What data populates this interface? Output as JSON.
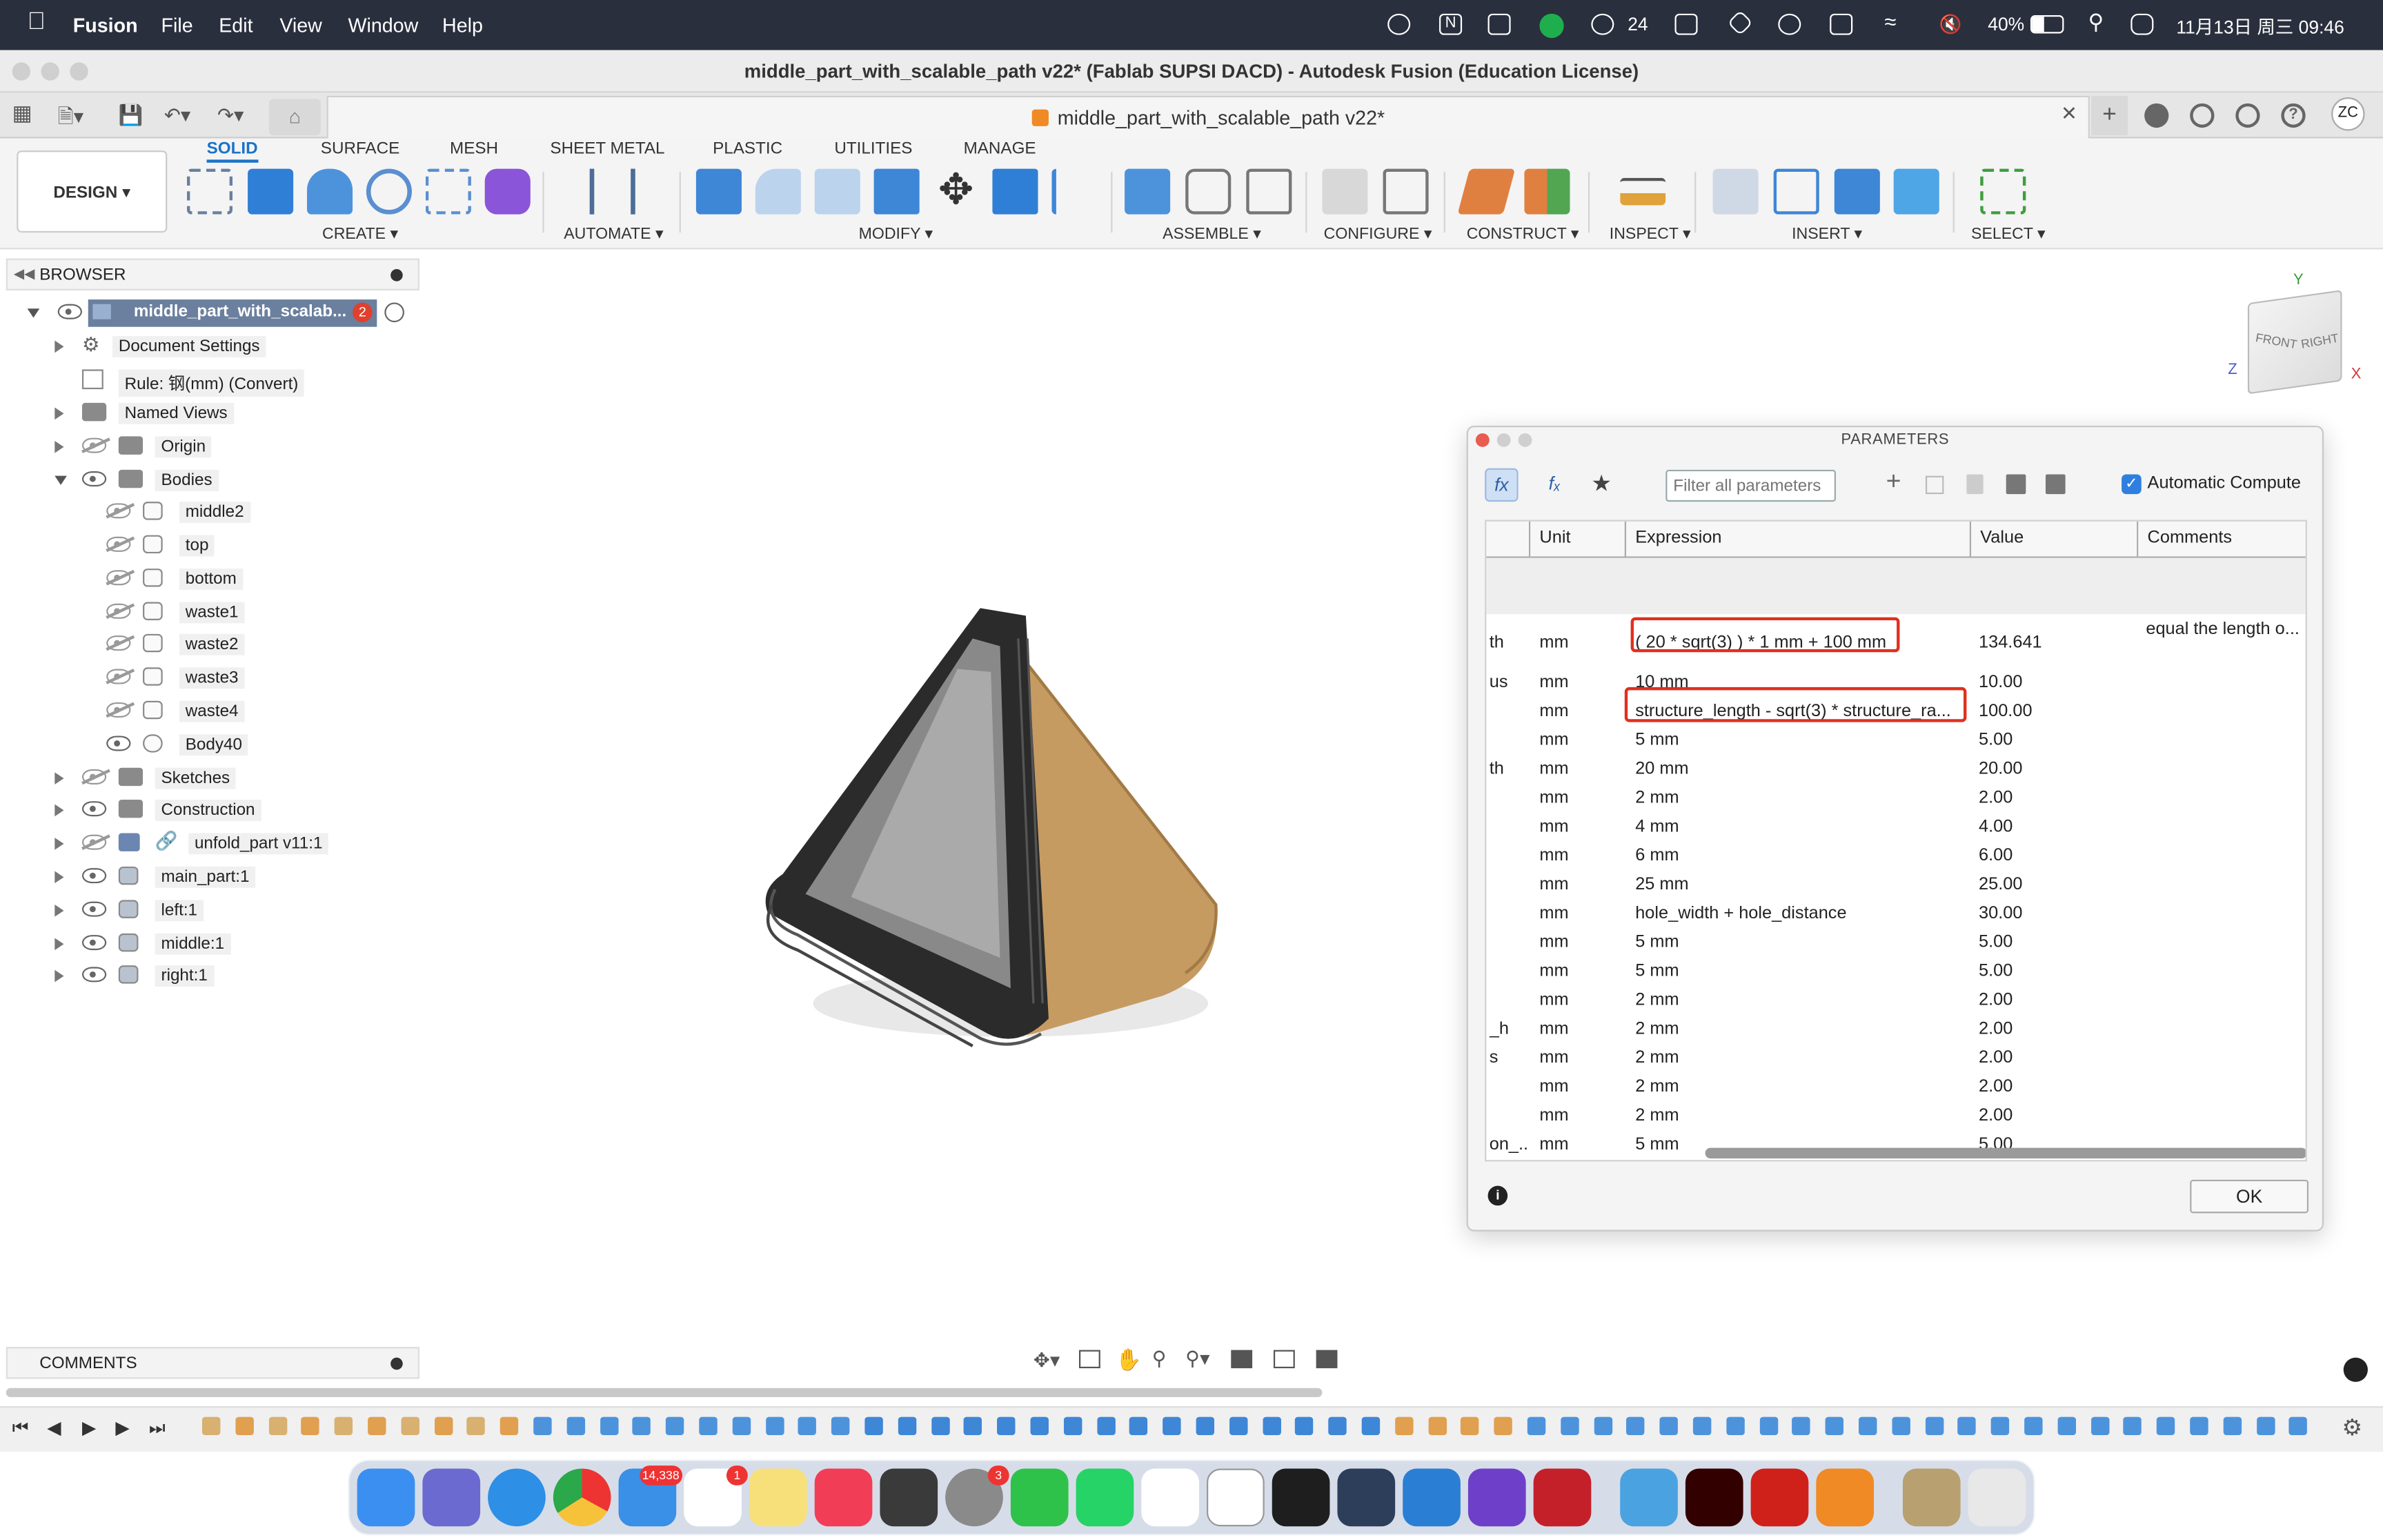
{
  "menubar": {
    "app": "Fusion",
    "items": [
      "File",
      "Edit",
      "View",
      "Window",
      "Help"
    ],
    "wechat_count": "24",
    "battery": "40%",
    "clock": "11月13日 周三 09:46"
  },
  "window": {
    "title": "middle_part_with_scalable_path v22* (Fablab SUPSI DACD) - Autodesk Fusion (Education License)",
    "doc_tab": "middle_part_with_scalable_path v22*",
    "user_initials": "ZC"
  },
  "toolbar": {
    "workspace": "DESIGN ▾",
    "tabs": [
      "SOLID",
      "SURFACE",
      "MESH",
      "SHEET METAL",
      "PLASTIC",
      "UTILITIES",
      "MANAGE"
    ],
    "groups": [
      "CREATE ▾",
      "AUTOMATE ▾",
      "MODIFY ▾",
      "ASSEMBLE ▾",
      "CONFIGURE ▾",
      "CONSTRUCT ▾",
      "INSPECT ▾",
      "INSERT ▾",
      "SELECT ▾"
    ]
  },
  "browser": {
    "title": "BROWSER",
    "root": "middle_part_with_scalab...",
    "root_badge": "2",
    "document_settings": "Document Settings",
    "rule": "Rule: 钢(mm) (Convert)",
    "named_views": "Named Views",
    "origin": "Origin",
    "bodies": "Bodies",
    "body_items": [
      "middle2",
      "top",
      "bottom",
      "waste1",
      "waste2",
      "waste3",
      "waste4",
      "Body40"
    ],
    "sketches": "Sketches",
    "construction": "Construction",
    "linked": "unfold_part v11:1",
    "components": [
      "main_part:1",
      "left:1",
      "middle:1",
      "right:1"
    ]
  },
  "viewcube": {
    "front": "FRONT",
    "right": "RIGHT",
    "y": "Y",
    "z": "Z",
    "x": "X"
  },
  "parameters": {
    "title": "PARAMETERS",
    "filter_placeholder": "Filter all parameters",
    "auto_compute": "Automatic Compute",
    "columns": [
      "Unit",
      "Expression",
      "Value",
      "Comments"
    ],
    "rows": [
      {
        "name": "th",
        "unit": "mm",
        "expr": "( 20 * sqrt(3) ) * 1 mm + 100 mm",
        "value": "134.641",
        "comment": "equal the length o..."
      },
      {
        "name": "us",
        "unit": "mm",
        "expr": "10 mm",
        "value": "10.00",
        "comment": ""
      },
      {
        "name": "",
        "unit": "mm",
        "expr": "structure_length - sqrt(3) * structure_ra...",
        "value": "100.00",
        "comment": ""
      },
      {
        "name": "",
        "unit": "mm",
        "expr": "5 mm",
        "value": "5.00",
        "comment": ""
      },
      {
        "name": "th",
        "unit": "mm",
        "expr": "20 mm",
        "value": "20.00",
        "comment": ""
      },
      {
        "name": "",
        "unit": "mm",
        "expr": "2 mm",
        "value": "2.00",
        "comment": ""
      },
      {
        "name": "",
        "unit": "mm",
        "expr": "4 mm",
        "value": "4.00",
        "comment": ""
      },
      {
        "name": "",
        "unit": "mm",
        "expr": "6 mm",
        "value": "6.00",
        "comment": ""
      },
      {
        "name": "",
        "unit": "mm",
        "expr": "25 mm",
        "value": "25.00",
        "comment": ""
      },
      {
        "name": "",
        "unit": "mm",
        "expr": "hole_width + hole_distance",
        "value": "30.00",
        "comment": ""
      },
      {
        "name": "",
        "unit": "mm",
        "expr": "5 mm",
        "value": "5.00",
        "comment": ""
      },
      {
        "name": "",
        "unit": "mm",
        "expr": "5 mm",
        "value": "5.00",
        "comment": ""
      },
      {
        "name": "",
        "unit": "mm",
        "expr": "2 mm",
        "value": "2.00",
        "comment": ""
      },
      {
        "name": "_h",
        "unit": "mm",
        "expr": "2 mm",
        "value": "2.00",
        "comment": ""
      },
      {
        "name": "s",
        "unit": "mm",
        "expr": "2 mm",
        "value": "2.00",
        "comment": ""
      },
      {
        "name": "",
        "unit": "mm",
        "expr": "2 mm",
        "value": "2.00",
        "comment": ""
      },
      {
        "name": "",
        "unit": "mm",
        "expr": "2 mm",
        "value": "2.00",
        "comment": ""
      },
      {
        "name": "on_...",
        "unit": "mm",
        "expr": "5 mm",
        "value": "5.00",
        "comment": ""
      }
    ],
    "ok": "OK"
  },
  "comments_panel": {
    "title": "COMMENTS"
  },
  "dock": {
    "mail_badge": "14,338",
    "reminders_badge": "1",
    "settings_badge": "3"
  }
}
